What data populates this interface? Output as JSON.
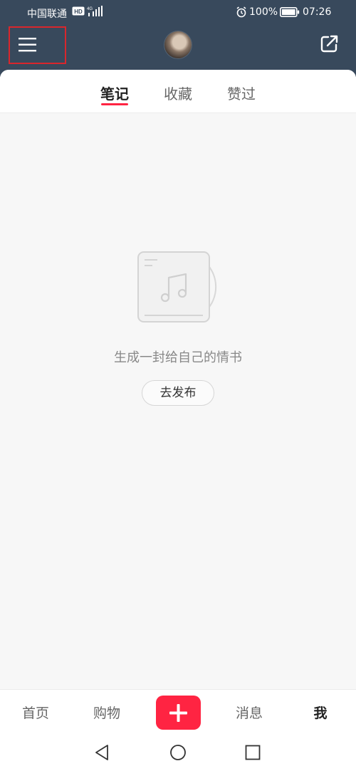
{
  "status_bar": {
    "carrier": "中国联通",
    "network_badge": "HD",
    "network_type": "4G",
    "battery": "100%",
    "time": "07:26",
    "icons": [
      "hd-icon",
      "signal-icon",
      "alarm-icon",
      "battery-icon"
    ]
  },
  "header": {
    "menu_icon": "hamburger-menu-icon",
    "avatar": "profile-avatar",
    "share_icon": "share-external-icon",
    "background": "#38495c"
  },
  "tabs": {
    "items": [
      {
        "label": "笔记",
        "active": true
      },
      {
        "label": "收藏",
        "active": false
      },
      {
        "label": "赞过",
        "active": false
      }
    ],
    "indicator_color": "#ff2442"
  },
  "empty_state": {
    "illustration": "music-note-record-icon",
    "message": "生成一封给自己的情书",
    "button_label": "去发布"
  },
  "bottom_nav": {
    "items": [
      {
        "label": "首页",
        "active": false
      },
      {
        "label": "购物",
        "active": false
      },
      {
        "label": "消息",
        "active": false
      },
      {
        "label": "我",
        "active": true
      }
    ],
    "plus_icon": "plus-icon",
    "accent": "#ff2442"
  },
  "system_nav": {
    "icons": [
      "back-triangle-icon",
      "home-circle-icon",
      "recent-square-icon"
    ]
  }
}
